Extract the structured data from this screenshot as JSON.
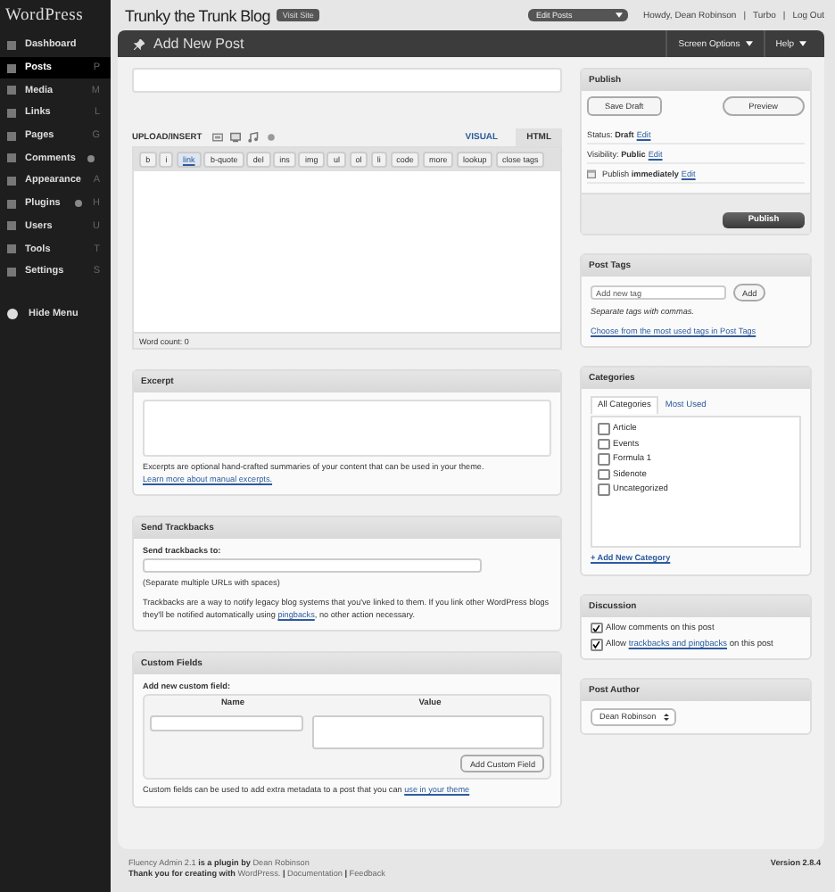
{
  "sidebar": {
    "logo": "WordPress",
    "items": [
      {
        "label": "Dashboard",
        "badge": false,
        "selected": false
      },
      {
        "label": "Posts",
        "shortcut": "P",
        "badge": false,
        "selected": true
      },
      {
        "label": "Media",
        "shortcut": "M",
        "badge": false,
        "selected": false
      },
      {
        "label": "Links",
        "shortcut": "L",
        "badge": false,
        "selected": false
      },
      {
        "label": "Pages",
        "shortcut": "G",
        "badge": false,
        "selected": false
      },
      {
        "label": "Comments",
        "badge": true,
        "selected": false
      },
      {
        "label": "Appearance",
        "shortcut": "A",
        "badge": false,
        "selected": false
      },
      {
        "label": "Plugins",
        "shortcut": "H",
        "badge": true,
        "selected": false
      },
      {
        "label": "Users",
        "shortcut": "U",
        "badge": false,
        "selected": false
      },
      {
        "label": "Tools",
        "shortcut": "T",
        "badge": false,
        "selected": false
      },
      {
        "label": "Settings",
        "shortcut": "S",
        "badge": false,
        "selected": false
      }
    ],
    "hide_menu": "Hide Menu"
  },
  "header": {
    "blog_title": "Trunky the Trunk Blog",
    "visit_site": "Visit Site",
    "favorite_action": "Edit Posts",
    "links": [
      "Howdy, Dean Robinson",
      "Turbo",
      "Log Out"
    ],
    "separator": "|"
  },
  "title_bar": {
    "title": "Add New Post",
    "screen_options": "Screen Options",
    "help": "Help"
  },
  "editor": {
    "upload_label": "UPLOAD/INSERT",
    "tabs": [
      {
        "label": "VISUAL",
        "selected": false
      },
      {
        "label": "HTML",
        "selected": true
      }
    ],
    "quicktags": [
      {
        "label": "b",
        "active": false
      },
      {
        "label": "i",
        "active": false
      },
      {
        "label": "link",
        "active": true
      },
      {
        "label": "b-quote",
        "active": false
      },
      {
        "label": "del",
        "active": false
      },
      {
        "label": "ins",
        "active": false
      },
      {
        "label": "img",
        "active": false
      },
      {
        "label": "ul",
        "active": false
      },
      {
        "label": "ol",
        "active": false
      },
      {
        "label": "li",
        "active": false
      },
      {
        "label": "code",
        "active": false
      },
      {
        "label": "more",
        "active": false
      },
      {
        "label": "lookup",
        "active": false
      },
      {
        "label": "close tags",
        "active": false
      }
    ],
    "word_count": "Word count: 0"
  },
  "excerpt": {
    "title": "Excerpt",
    "note": "Excerpts are optional hand-crafted summaries of your content that can be used in your theme.",
    "link": "Learn more about manual excerpts."
  },
  "trackbacks": {
    "title": "Send Trackbacks",
    "label": "Send trackbacks to:",
    "hint": "(Separate multiple URLs with spaces)",
    "note_before": "Trackbacks are a way to notify legacy blog systems that you've linked to them. If you link other WordPress blogs they'll be notified automatically using",
    "link": "pingbacks",
    "note_after": ", no other action necessary."
  },
  "custom_fields": {
    "title": "Custom Fields",
    "label": "Add new custom field:",
    "columns": [
      "Name",
      "Value"
    ],
    "button": "Add Custom Field",
    "note": "Custom fields can be used to add extra metadata to a post that you can",
    "link": "use in your theme"
  },
  "publish": {
    "title": "Publish",
    "save_draft": "Save Draft",
    "preview": "Preview",
    "rows": [
      {
        "label": "Status:",
        "value": "Draft",
        "edit": "Edit",
        "kind": "plain"
      },
      {
        "label": "Visibility:",
        "value": "Public",
        "edit": "Edit",
        "kind": "plain"
      },
      {
        "label": "Publish",
        "value": "immediately",
        "edit": "Edit",
        "kind": "calendar"
      }
    ],
    "button": "Publish"
  },
  "post_tags": {
    "title": "Post Tags",
    "placeholder": "Add new tag",
    "button": "Add",
    "hint": "Separate tags with commas.",
    "link": "Choose from the most used tags in Post Tags"
  },
  "categories": {
    "title": "Categories",
    "tabs": [
      {
        "label": "All Categories",
        "selected": true
      },
      {
        "label": "Most Used",
        "selected": false
      }
    ],
    "items": [
      {
        "label": "Article",
        "checked": false
      },
      {
        "label": "Events",
        "checked": false
      },
      {
        "label": "Formula 1",
        "checked": false
      },
      {
        "label": "Sidenote",
        "checked": false
      },
      {
        "label": "Uncategorized",
        "checked": false
      }
    ],
    "add_link": "+ Add New Category"
  },
  "discussion": {
    "title": "Discussion",
    "options": [
      {
        "text_before": "Allow comments on this post",
        "checked": true
      },
      {
        "text_before": "Allow",
        "link": "trackbacks and pingbacks",
        "text_after": "on this post",
        "checked": true
      }
    ]
  },
  "post_author": {
    "title": "Post Author",
    "value": "Dean Robinson"
  },
  "footer": {
    "plugin_link": "Fluency Admin 2.1",
    "plugin_text": "is a plugin by",
    "author_link": "Dean Robinson",
    "thanks": "Thank you for creating with",
    "links": [
      "WordPress.",
      "Documentation",
      "Feedback"
    ],
    "separator": "|",
    "version": "Version 2.8.4"
  }
}
